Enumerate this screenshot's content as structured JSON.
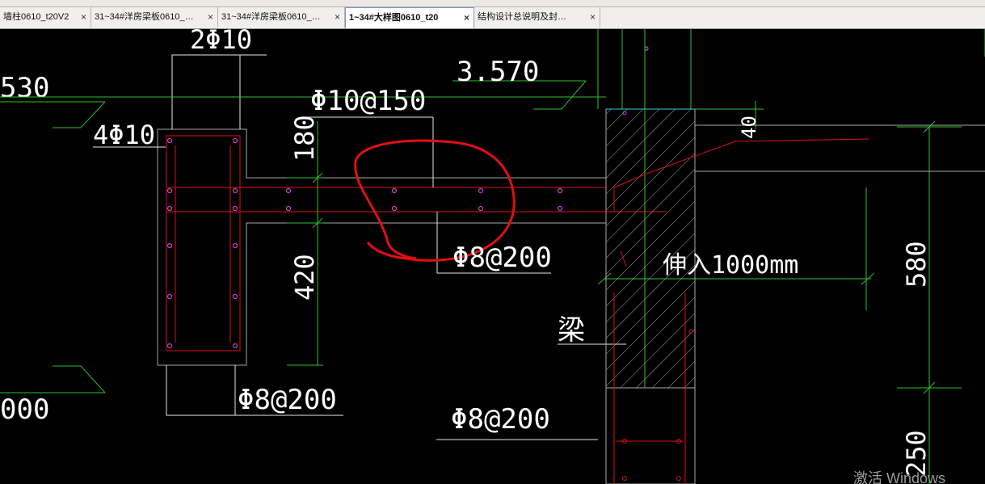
{
  "tabs": [
    {
      "label": "墙柱0610_t20V2",
      "close": "×",
      "active": false
    },
    {
      "label": "31~34#洋房梁板0610_…",
      "close": "×",
      "active": false
    },
    {
      "label": "31~34#洋房梁板0610_…",
      "close": "×",
      "active": false
    },
    {
      "label": "1~34#大样图0610_t20",
      "close": "×",
      "active": true
    },
    {
      "label": "结构设计总说明及封…",
      "close": "×",
      "active": false
    }
  ],
  "drawing": {
    "rebar_top": "2Φ10",
    "elev_left": "530",
    "elev_right": "3.570",
    "stirrup_top": "Φ10@150",
    "corner_bars": "4Φ10",
    "dim_180": "180",
    "dim_420": "420",
    "stirrup_mid": "Φ8@200",
    "stirrup_bottom_left": "Φ8@200",
    "stirrup_bottom_right": "Φ8@200",
    "elev_bottom_left": "000",
    "dim_40": "40",
    "anchor_note": "伸入1000mm",
    "beam_label": "梁",
    "dim_580": "580",
    "dim_250": "250"
  },
  "watermark": "激活 Windows"
}
